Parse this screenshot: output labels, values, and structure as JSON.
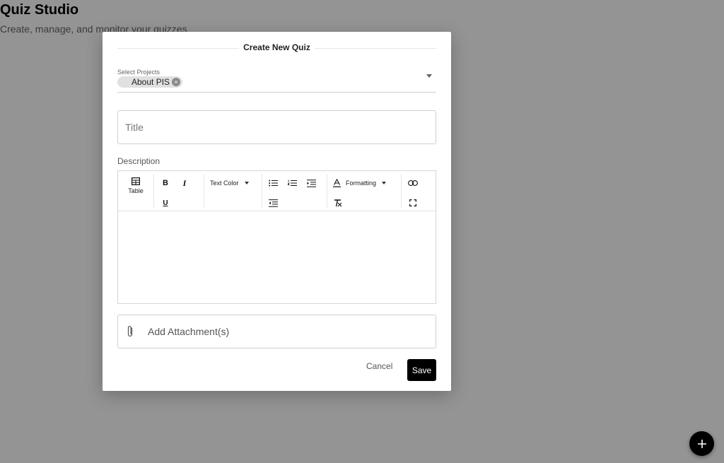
{
  "page": {
    "title": "Quiz Studio",
    "subtitle": "Create, manage, and monitor your quizzes"
  },
  "fab": {
    "icon": "plus-icon",
    "color": "#000000"
  },
  "modal": {
    "title": "Create New Quiz",
    "projects": {
      "label": "Select Projects",
      "chips": [
        "About PIS"
      ],
      "dropdown_icon": "caret-down-icon"
    },
    "title_field": {
      "placeholder": "Title",
      "value": ""
    },
    "description": {
      "label": "Description",
      "toolbar": {
        "table_label": "Table",
        "text_color_label": "Text Color",
        "formatting_label": "Formatting",
        "icons": [
          "table-icon",
          "bold-icon",
          "italic-icon",
          "underline-icon",
          "bulleted-list-icon",
          "numbered-list-icon",
          "indent-icon",
          "outdent-icon",
          "font-color-icon",
          "clear-formatting-icon",
          "link-icon",
          "fullscreen-icon"
        ]
      },
      "content": ""
    },
    "attachment": {
      "label": "Add Attachment(s)",
      "icon": "paperclip-icon"
    },
    "actions": {
      "cancel": "Cancel",
      "save": "Save"
    }
  },
  "colors": {
    "primary": "#000000",
    "backdrop": "rgba(0,0,0,0.42)",
    "chip_bg": "#e0e0e0"
  }
}
